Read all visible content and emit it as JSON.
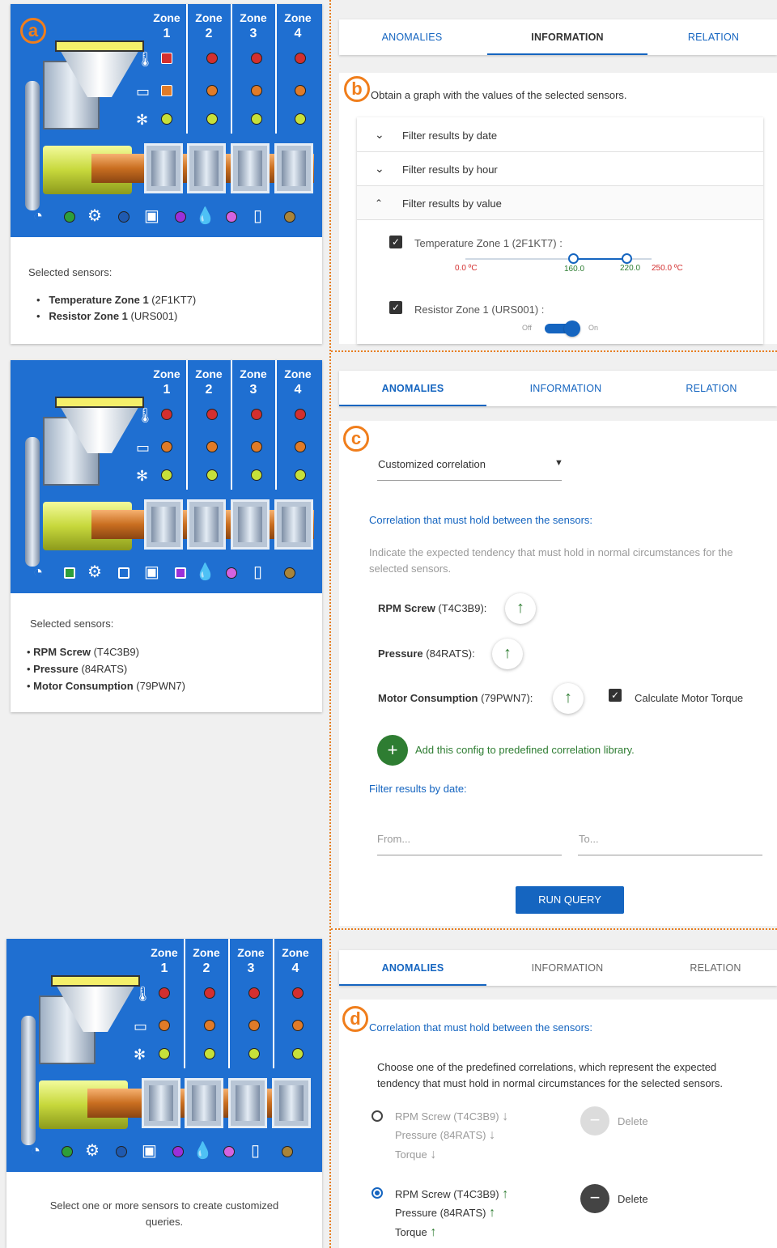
{
  "panel_labels": {
    "a": "a",
    "b": "b",
    "c": "c",
    "d": "d"
  },
  "colors": {
    "machine_bg": "#1f6fd1",
    "accent_orange": "#e87d1e",
    "primary_blue": "#1565c0",
    "green": "#2e7d32",
    "red": "#d32f2f"
  },
  "zones": [
    {
      "title": "Zone",
      "num": "1"
    },
    {
      "title": "Zone",
      "num": "2"
    },
    {
      "title": "Zone",
      "num": "3"
    },
    {
      "title": "Zone",
      "num": "4"
    }
  ],
  "sensor_row_icons": [
    "thermometer-icon",
    "resistor-icon",
    "fan-icon"
  ],
  "bottom_icons": [
    "gauge-icon",
    "motor-icon",
    "meter-icon",
    "humidity-icon",
    "bottle-icon"
  ],
  "panel_a": {
    "selected_title": "Selected sensors:",
    "items": [
      {
        "bold": "Temperature Zone 1",
        "rest": " (2F1KT7)"
      },
      {
        "bold": "Resistor Zone 1",
        "rest": " (URS001)"
      }
    ]
  },
  "panel_b": {
    "tabs": [
      "ANOMALIES",
      "INFORMATION",
      "RELATION"
    ],
    "intro": "Obtain a graph with the values of the selected sensors.",
    "filters": [
      "Filter results by date",
      "Filter results by hour",
      "Filter results by value"
    ],
    "temp_label": "Temperature Zone 1 (2F1KT7) :",
    "slider_min": "0.0 ºC",
    "slider_low": "160.0",
    "slider_high": "220.0",
    "slider_max": "250.0 ºC",
    "resistor_label": "Resistor Zone 1 (URS001) :",
    "toggle_off": "Off",
    "toggle_on": "On"
  },
  "panel_c_left": {
    "selected_title": "Selected sensors:",
    "items": [
      {
        "bold": "RPM Screw",
        "rest": " (T4C3B9)"
      },
      {
        "bold": "Pressure",
        "rest": " (84RATS)"
      },
      {
        "bold": "Motor Consumption",
        "rest": " (79PWN7)"
      }
    ]
  },
  "panel_c": {
    "tabs": [
      "ANOMALIES",
      "INFORMATION",
      "RELATION"
    ],
    "select_value": "Customized correlation",
    "section_title": "Correlation that must hold between the sensors:",
    "hint_line1": "Indicate the expected tendency that must hold in normal circumstances for the",
    "hint_line2": "selected sensors.",
    "rows": [
      {
        "bold": "RPM Screw",
        "rest": " (T4C3B9):"
      },
      {
        "bold": "Pressure",
        "rest": " (84RATS):"
      },
      {
        "bold": "Motor Consumption",
        "rest": " (79PWN7):"
      }
    ],
    "motor_torque": "Calculate Motor Torque",
    "add_config": "Add this config to predefined correlation library.",
    "filter_date": "Filter results by date:",
    "from_placeholder": "From...",
    "to_placeholder": "To...",
    "run_query": "RUN QUERY"
  },
  "panel_d_left": {
    "line1": "Select one or more sensors to create customized",
    "line2": "queries."
  },
  "panel_d": {
    "tabs": [
      "ANOMALIES",
      "INFORMATION",
      "RELATION"
    ],
    "section_title": "Correlation that must hold between the sensors:",
    "desc_line1": "Choose one of the predefined correlations, which represent the expected",
    "desc_line2": "tendency that must hold in normal circumstances for the selected sensors.",
    "options": [
      {
        "lines": [
          "RPM Screw (T4C3B9)",
          "Pressure (84RATS)",
          "Torque"
        ],
        "arrow": "↓",
        "delete": "Delete",
        "selected": false
      },
      {
        "lines": [
          "RPM Screw (T4C3B9)",
          "Pressure (84RATS)",
          "Torque"
        ],
        "arrow": "↑",
        "delete": "Delete",
        "selected": true
      }
    ]
  }
}
